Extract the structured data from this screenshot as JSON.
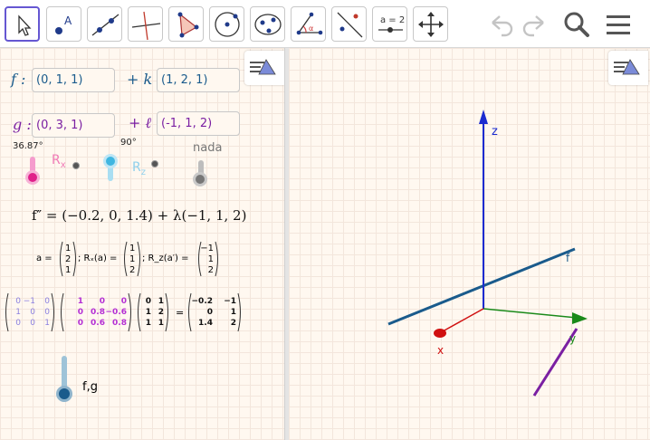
{
  "toolbar": {
    "tools": [
      {
        "name": "move-tool-button",
        "icon": "cursor-arrow-icon"
      },
      {
        "name": "point-tool-button",
        "icon": "point-icon",
        "label": "A"
      },
      {
        "name": "line-tool-button",
        "icon": "line-icon"
      },
      {
        "name": "perpendicular-tool-button",
        "icon": "perpendicular-line-icon"
      },
      {
        "name": "polygon-tool-button",
        "icon": "triangle-icon"
      },
      {
        "name": "circle-tool-button",
        "icon": "circle-icon"
      },
      {
        "name": "conic-tool-button",
        "icon": "ellipse-icon"
      },
      {
        "name": "angle-tool-button",
        "icon": "angle-icon",
        "label": "α"
      },
      {
        "name": "reflect-tool-button",
        "icon": "reflect-icon"
      },
      {
        "name": "slider-tool-button",
        "icon": "slider-icon",
        "label": "a = 2"
      },
      {
        "name": "move-view-tool-button",
        "icon": "move-arrows-icon"
      }
    ],
    "right": [
      "undo-icon",
      "redo-icon",
      "search-icon",
      "menu-icon"
    ]
  },
  "algebra": {
    "f_label": "f :",
    "f_point": "(0, 1, 1)",
    "f_plus": "+ k",
    "f_dir": "(1, 2, 1)",
    "g_label": "g :",
    "g_point": "(0, 3, 1)",
    "g_plus": "+ ℓ",
    "g_dir": "(-1, 1, 2)",
    "slider_rx_value": "36.87°",
    "slider_rx_label": "R",
    "slider_rx_sub": "x",
    "slider_rz_value": "90°",
    "slider_rz_label": "R",
    "slider_rz_sub": "z",
    "slider_nada_label": "nada",
    "equation": "f″ = (−0.2, 0, 1.4) + λ(−1, 1, 2)",
    "vector_line": {
      "a_label": "a =",
      "a_vec": [
        "1",
        "2",
        "1"
      ],
      "rx_label": "; Rₓ(a) =",
      "rx_vec": [
        "1",
        "1",
        "2"
      ],
      "rz_label": "; R_z(a′) =",
      "rz_vec": [
        "−1",
        "1",
        "2"
      ]
    },
    "matrix_product": {
      "m1": [
        [
          "0",
          "−1",
          "0"
        ],
        [
          "1",
          "0",
          "0"
        ],
        [
          "0",
          "0",
          "1"
        ]
      ],
      "m2": [
        [
          "1",
          "0",
          "0"
        ],
        [
          "0",
          "0.8",
          "−0.6"
        ],
        [
          "0",
          "0.6",
          "0.8"
        ]
      ],
      "m3": [
        [
          "0",
          "1"
        ],
        [
          "1",
          "2"
        ],
        [
          "1",
          "1"
        ]
      ],
      "eq": "=",
      "result": [
        [
          "−0.2",
          "−1"
        ],
        [
          "0",
          "1"
        ],
        [
          "1.4",
          "2"
        ]
      ]
    },
    "fg_label": "f,g"
  },
  "graphics": {
    "axis_z": "z",
    "axis_x": "x",
    "axis_y": "y",
    "line_f": "f"
  },
  "colors": {
    "f": "#1a5b8c",
    "g": "#7a1fa2",
    "pink": "#e0208a",
    "cyan": "#3fb6e0",
    "gray": "#777777",
    "axis_z": "#1a2bd0",
    "axis_x": "#d01010",
    "axis_y": "#1a8a1a"
  }
}
